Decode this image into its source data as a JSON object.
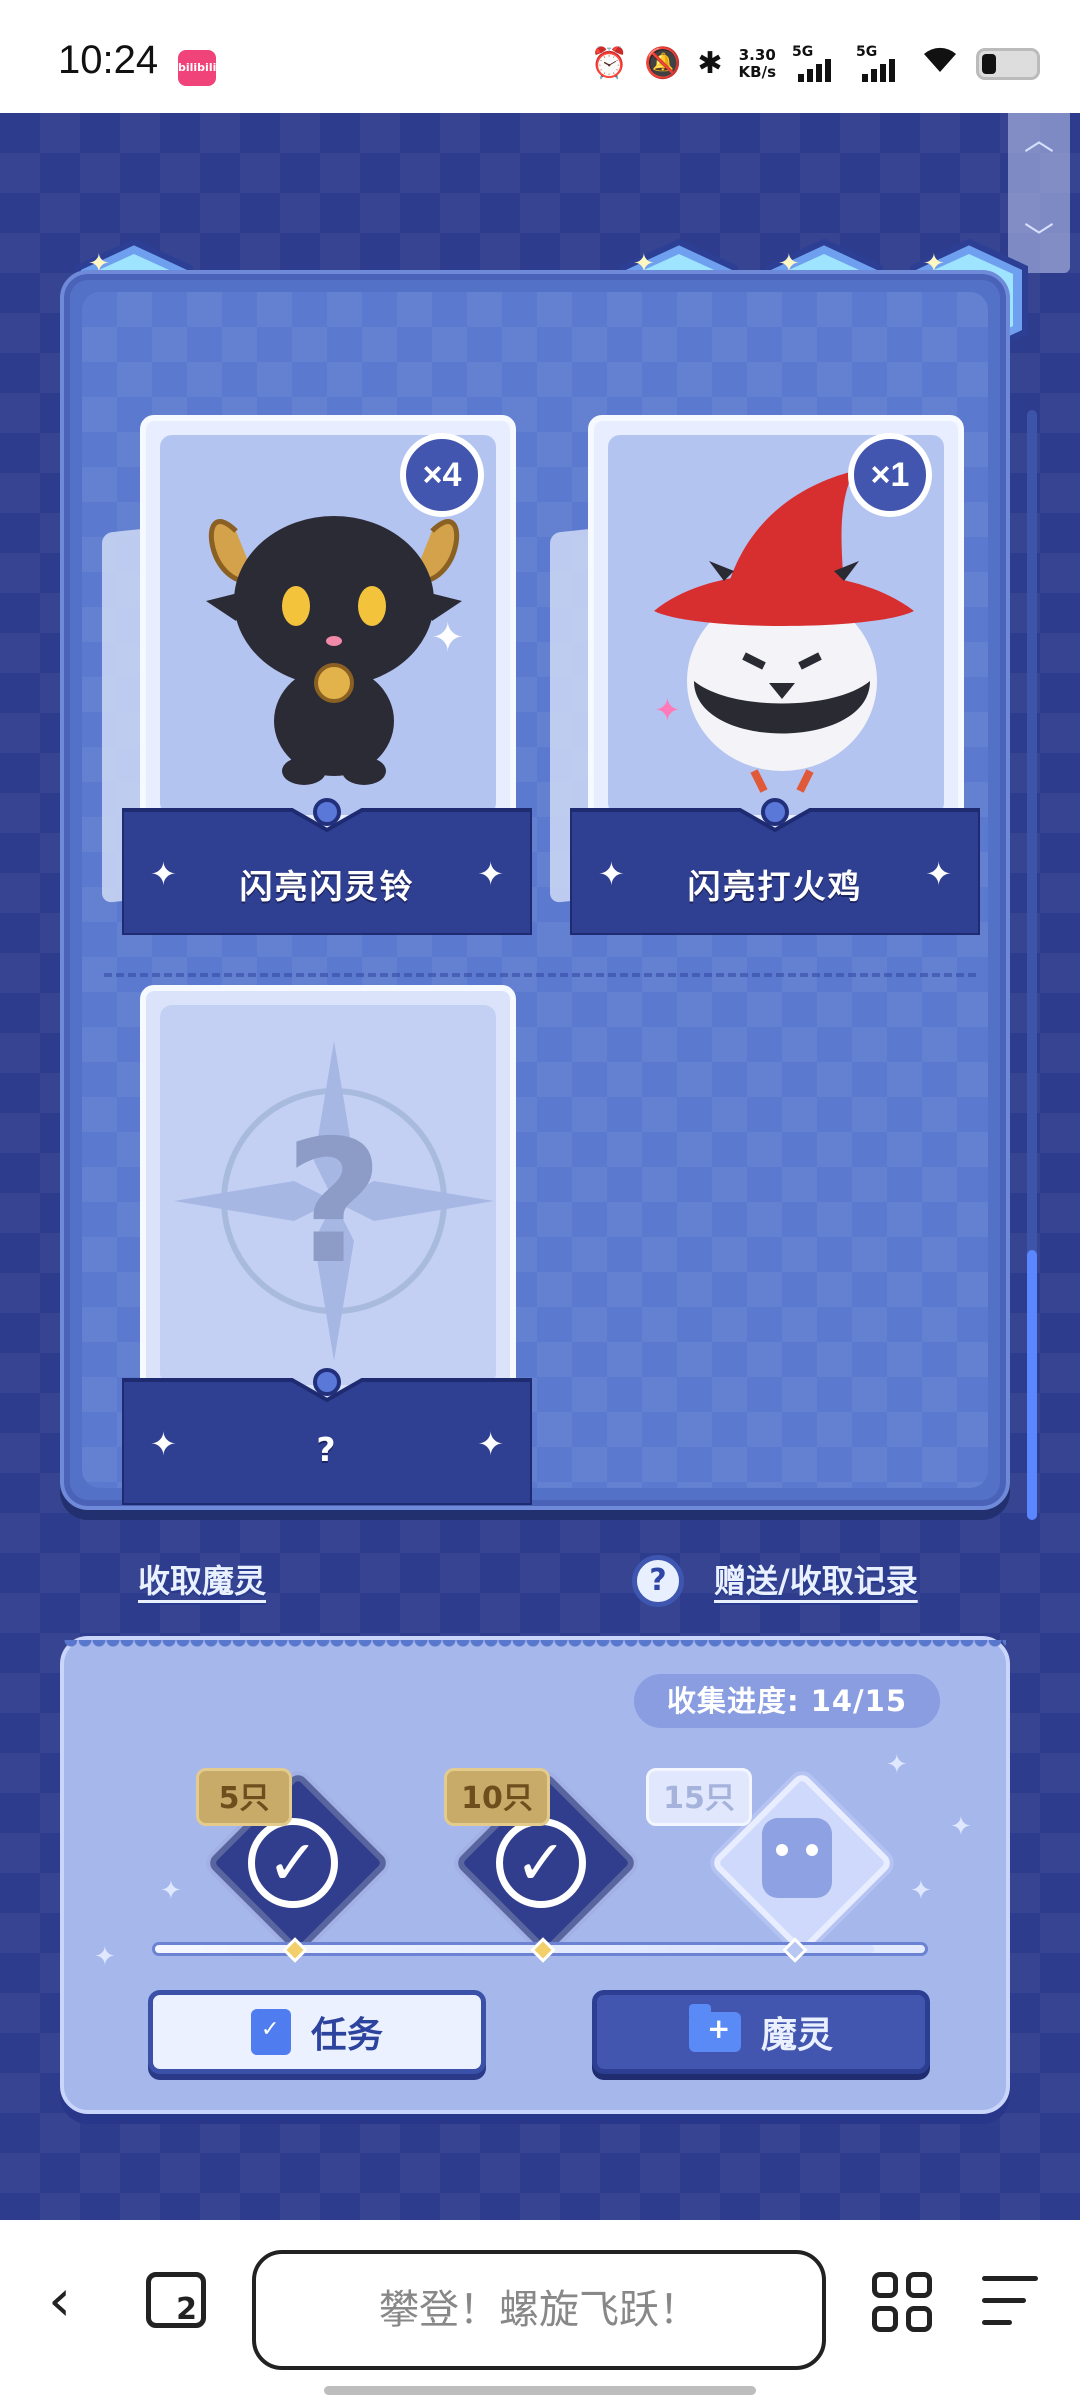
{
  "status_bar": {
    "time": "10:24",
    "app_badge": "bilibili",
    "net_speed_value": "3.30",
    "net_speed_unit": "KB/s",
    "signal_1": "5G",
    "signal_2": "5G",
    "icons": [
      "alarm-icon",
      "mute-icon",
      "bluetooth-icon",
      "signal-icon",
      "signal-icon",
      "wifi-icon",
      "battery-icon"
    ]
  },
  "toolbar": {
    "home_icon": "home-icon",
    "help_icon": "help-icon",
    "music_icon": "music-icon",
    "share_icon": "share-icon"
  },
  "cards": [
    {
      "name": "闪亮闪灵铃",
      "count": "×4",
      "state": "owned"
    },
    {
      "name": "闪亮打火鸡",
      "count": "×1",
      "state": "owned"
    },
    {
      "name": "?",
      "count": "",
      "state": "unknown"
    }
  ],
  "links": {
    "collect": "收取魔灵",
    "records": "赠送/收取记录",
    "help_glyph": "?"
  },
  "progress": {
    "label": "收集进度: 14/15",
    "current": 14,
    "total": 15,
    "milestones": [
      {
        "label": "5只",
        "claimed": true
      },
      {
        "label": "10只",
        "claimed": true
      },
      {
        "label": "15只",
        "claimed": false
      }
    ]
  },
  "buttons": {
    "task": "任务",
    "spirit": "魔灵"
  },
  "browser": {
    "tab_count": "2",
    "address_text": "攀登！螺旋飞跃！"
  },
  "colors": {
    "background": "#2e3c8e",
    "panel": "#5471c8",
    "accent": "#4256b0",
    "gold": "#c8ab69"
  }
}
